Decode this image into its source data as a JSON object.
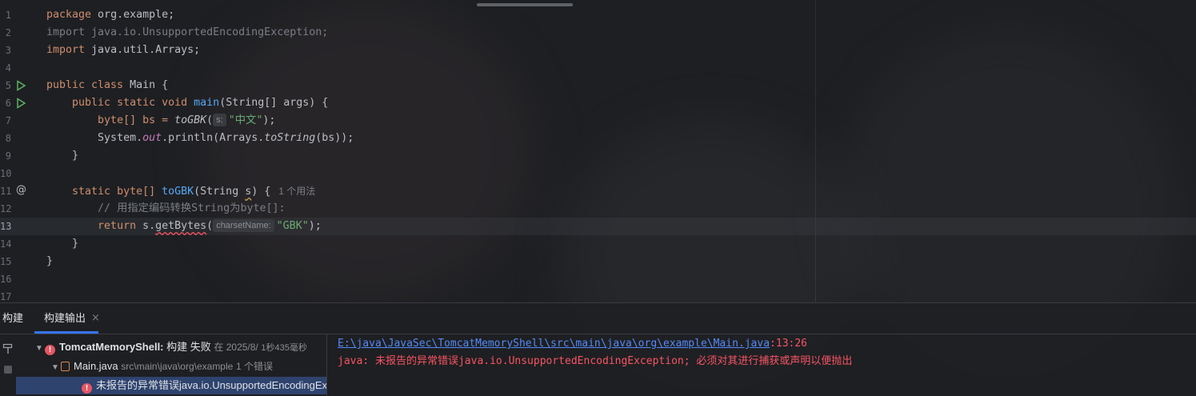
{
  "editor": {
    "lines": [
      {
        "n": "1"
      },
      {
        "n": "2"
      },
      {
        "n": "3"
      },
      {
        "n": "4"
      },
      {
        "n": "5"
      },
      {
        "n": "6"
      },
      {
        "n": "7"
      },
      {
        "n": "8"
      },
      {
        "n": "9"
      },
      {
        "n": "10"
      },
      {
        "n": "11"
      },
      {
        "n": "12"
      },
      {
        "n": "13"
      },
      {
        "n": "14"
      },
      {
        "n": "15"
      },
      {
        "n": "16"
      },
      {
        "n": "17"
      }
    ],
    "code": {
      "l1_kw": "package",
      "l1_rest": " org.example;",
      "l2": "import java.io.UnsupportedEncodingException;",
      "l3_kw": "import",
      "l3_rest": " java.util.Arrays;",
      "l5_kw": "public class",
      "l5_rest": " Main {",
      "l6_kw": "public static void",
      "l6_fn": "main",
      "l6_rest": "(String[] args) {",
      "l7_a": "byte[] bs = ",
      "l7_fn": "toGBK",
      "l7_paren": "(",
      "l7_hint": "s:",
      "l7_str": "\"中文\"",
      "l7_end": ");",
      "l8_a": "System.",
      "l8_out": "out",
      "l8_b": ".println(Arrays.",
      "l8_fn": "toString",
      "l8_c": "(bs));",
      "l9": "}",
      "l11_kw": "static",
      "l11_a": " byte[] ",
      "l11_fn": "toGBK",
      "l11_b": "(String ",
      "l11_s": "s",
      "l11_c": ") {",
      "l11_usage": "1 个用法",
      "l12": "// 用指定编码转换String为byte[]:",
      "l13_kw": "return",
      "l13_a": " s.",
      "l13_fn": "getBytes",
      "l13_paren": "(",
      "l13_hint": "charsetName:",
      "l13_str": "\"GBK\"",
      "l13_end": ");",
      "l14": "}",
      "l15": "}"
    }
  },
  "panel": {
    "tab_build": "构建",
    "tab_output": "构建输出",
    "tab_close": "×",
    "tree": {
      "root_name": "TomcatMemoryShell:",
      "root_status": "构建 失败",
      "root_meta": "在 2025/8/",
      "root_time": "1秒435毫秒",
      "file_name": "Main.java",
      "file_path": "src\\main\\java\\org\\example",
      "file_errors": "1 个错误",
      "error_msg": "未报告的异常错误java.io.UnsupportedEncodingExce"
    },
    "output": {
      "path_link": "E:\\java\\JavaSec\\TomcatMemoryShell\\src\\main\\java\\org\\example\\Main.java",
      "path_pos": ":13:26",
      "error_line": "java: 未报告的异常错误java.io.UnsupportedEncodingException; 必须对其进行捕获或声明以便抛出"
    }
  },
  "colors": {
    "keyword": "#cf8e6d",
    "function": "#56a8f5",
    "string": "#6aab73",
    "error": "#f75464",
    "link": "#548af7",
    "accent": "#3574f0"
  }
}
